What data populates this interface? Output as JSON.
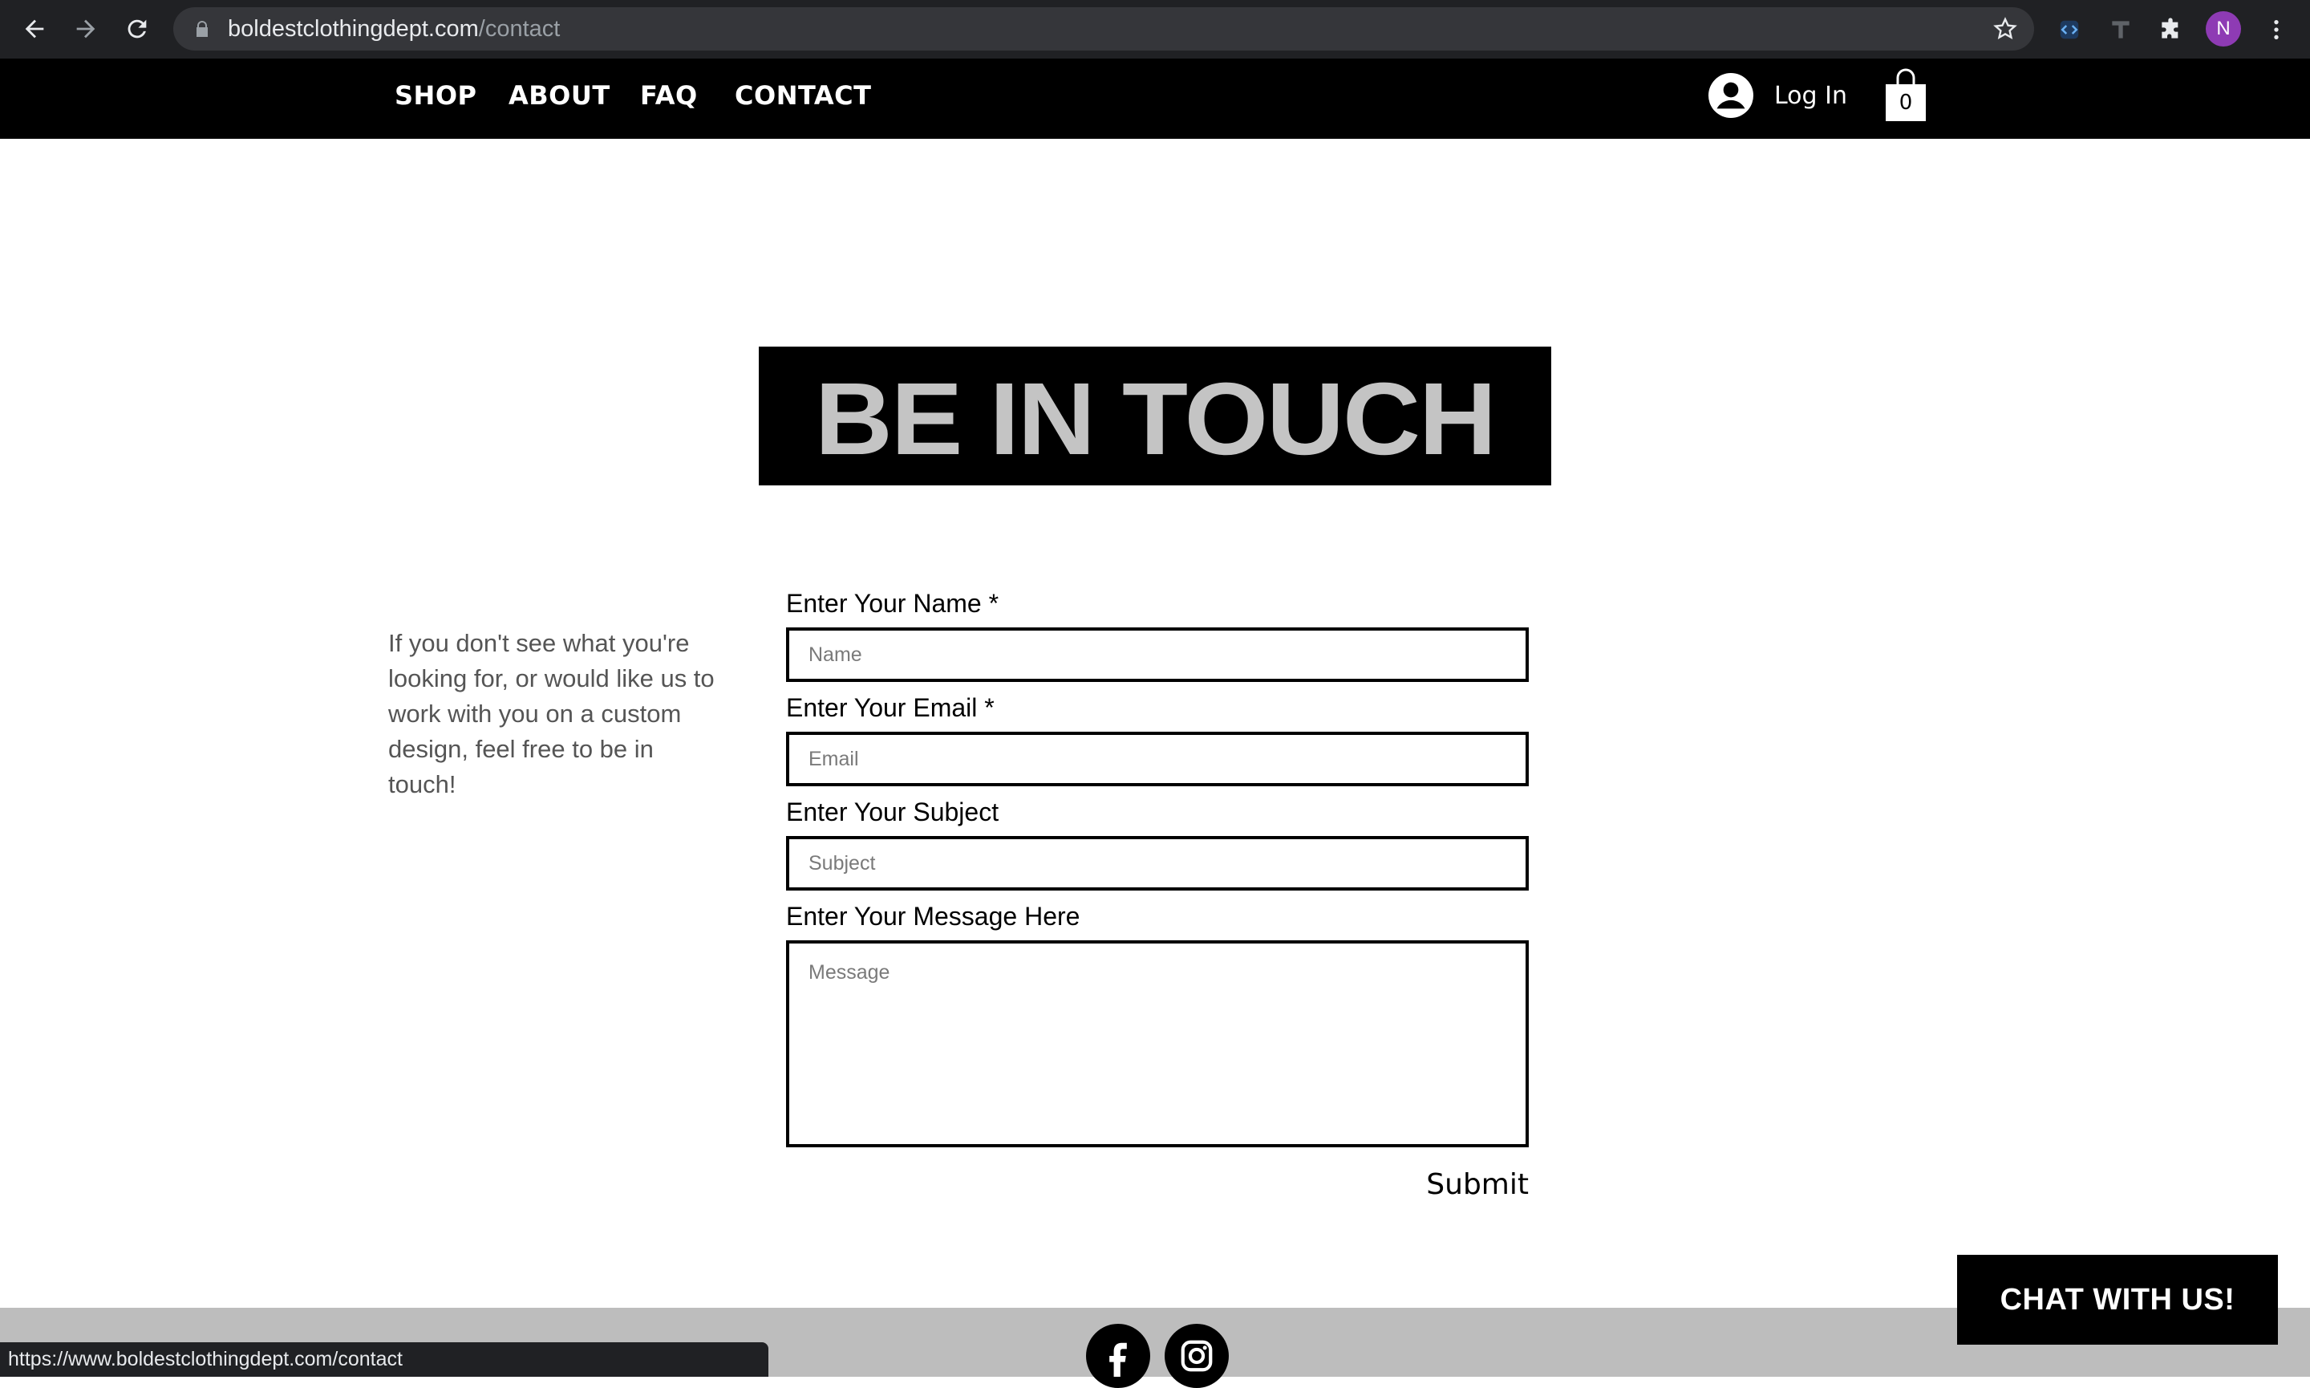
{
  "browser": {
    "url_host": "boldestclothingdept.com",
    "url_path": "/contact",
    "profile_initial": "N",
    "status_url": "https://www.boldestclothingdept.com/contact"
  },
  "header": {
    "nav": [
      "SHOP",
      "ABOUT",
      "FAQ",
      "CONTACT"
    ],
    "login_label": "Log In",
    "cart_count": "0"
  },
  "main": {
    "banner_title": "BE IN TOUCH",
    "intro_text": "If you don't see what you're looking for, or would like us to work with you on a custom design, feel free to be in touch!",
    "form": {
      "name_label": "Enter Your Name *",
      "name_placeholder": "Name",
      "email_label": "Enter Your Email *",
      "email_placeholder": "Email",
      "subject_label": "Enter Your Subject",
      "subject_placeholder": "Subject",
      "message_label": "Enter Your Message Here",
      "message_placeholder": "Message",
      "submit_label": "Submit"
    }
  },
  "chat_label": "CHAT WITH US!",
  "colors": {
    "header_bg": "#000000",
    "banner_text": "#c4c4c4",
    "footer_bg": "#bdbdbd",
    "profile": "#8e3bb4"
  },
  "icons": [
    "back-arrow-icon",
    "forward-arrow-icon",
    "reload-icon",
    "lock-icon",
    "star-icon",
    "extension-icon",
    "puzzle-icon",
    "menu-dots-icon",
    "user-avatar-icon",
    "shopping-bag-icon",
    "facebook-icon",
    "instagram-icon"
  ]
}
